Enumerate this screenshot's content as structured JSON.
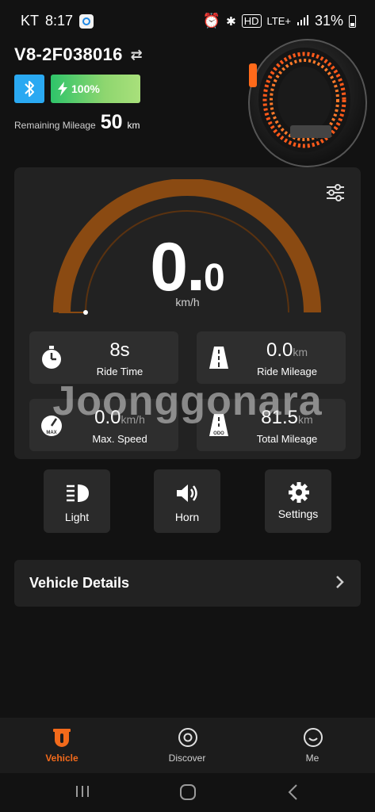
{
  "status_bar": {
    "carrier": "KT",
    "time": "8:17",
    "hd": "HD",
    "network": "LTE+",
    "battery": "31%"
  },
  "header": {
    "device_name": "V8-2F038016",
    "battery_label": "100%",
    "battery_level": 1.0,
    "remaining_label": "Remaining Mileage",
    "remaining_value": "50",
    "remaining_unit": "km"
  },
  "dashboard": {
    "speed_int": "0.",
    "speed_dec": "0",
    "speed_unit": "km/h",
    "stats": [
      {
        "value": "8s",
        "unit": "",
        "label": "Ride Time",
        "icon": "stopwatch-icon"
      },
      {
        "value": "0.0",
        "unit": "km",
        "label": "Ride Mileage",
        "icon": "road-icon"
      },
      {
        "value": "0.0",
        "unit": "km/h",
        "label": "Max. Speed",
        "icon": "max-gauge-icon"
      },
      {
        "value": "81.5",
        "unit": "km",
        "label": "Total Mileage",
        "icon": "odo-road-icon"
      }
    ],
    "max_badge": "MAX",
    "odo_badge": "ODO"
  },
  "watermark": "Joonggonara",
  "quick_actions": [
    {
      "label": "Light",
      "icon": "headlight-icon"
    },
    {
      "label": "Horn",
      "icon": "horn-icon"
    },
    {
      "label": "Settings",
      "icon": "gear-icon"
    }
  ],
  "vehicle_details": {
    "label": "Vehicle Details"
  },
  "bottom_nav": [
    {
      "label": "Vehicle",
      "active": true,
      "icon": "vehicle-icon"
    },
    {
      "label": "Discover",
      "active": false,
      "icon": "discover-icon"
    },
    {
      "label": "Me",
      "active": false,
      "icon": "smile-icon"
    }
  ],
  "colors": {
    "accent": "#f26a1b",
    "bluetooth": "#2aa9f2",
    "battery_green": "#2ec46a",
    "gauge_brown": "#8a4a12"
  }
}
